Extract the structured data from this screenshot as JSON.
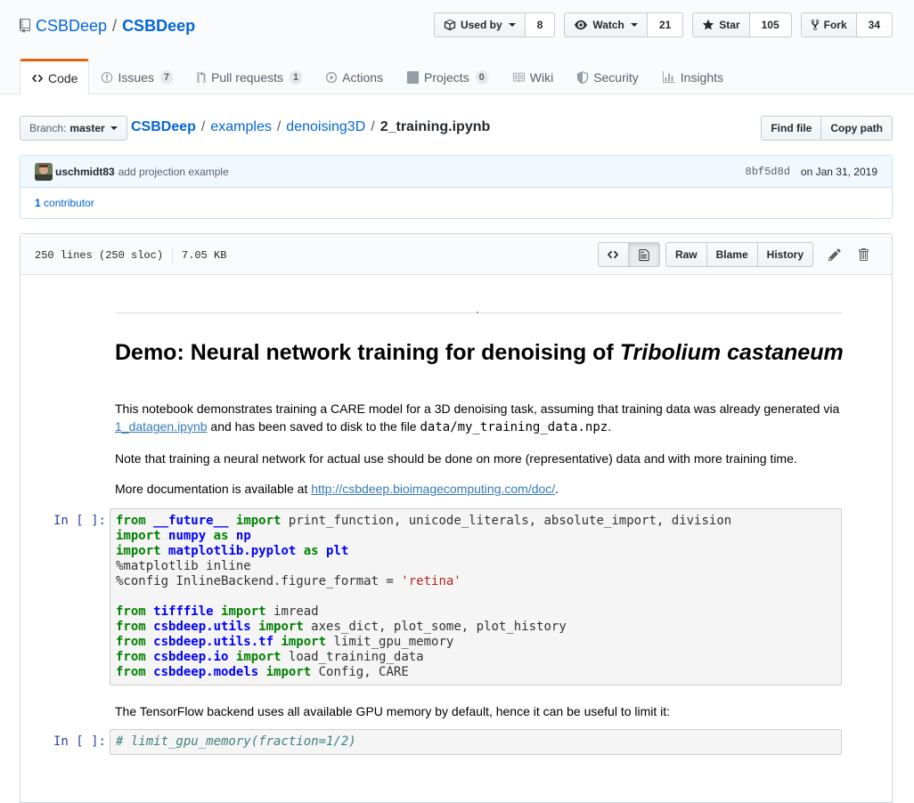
{
  "repo": {
    "owner": "CSBDeep",
    "separator": "/",
    "name": "CSBDeep"
  },
  "actions": {
    "used_by": {
      "label": "Used by",
      "count": "8"
    },
    "watch": {
      "label": "Watch",
      "count": "21"
    },
    "star": {
      "label": "Star",
      "count": "105"
    },
    "fork": {
      "label": "Fork",
      "count": "34"
    }
  },
  "tabs": [
    {
      "label": "Code",
      "icon": "code-icon",
      "selected": true
    },
    {
      "label": "Issues",
      "icon": "issue-icon",
      "counter": "7"
    },
    {
      "label": "Pull requests",
      "icon": "pull-request-icon",
      "counter": "1"
    },
    {
      "label": "Actions",
      "icon": "play-icon"
    },
    {
      "label": "Projects",
      "icon": "project-icon",
      "counter": "0"
    },
    {
      "label": "Wiki",
      "icon": "book-icon"
    },
    {
      "label": "Security",
      "icon": "shield-icon"
    },
    {
      "label": "Insights",
      "icon": "graph-icon"
    }
  ],
  "filenav": {
    "branch_prefix": "Branch:",
    "branch": "master",
    "crumbs": [
      "CSBDeep",
      "examples",
      "denoising3D"
    ],
    "separator": "/",
    "file": "2_training.ipynb",
    "find_file": "Find file",
    "copy_path": "Copy path"
  },
  "commit": {
    "author": "uschmidt83",
    "message": "add projection example",
    "sha": "8bf5d8d",
    "date": "on Jan 31, 2019",
    "contributors_count": "1",
    "contributors_label": "contributor"
  },
  "file": {
    "lines": "250 lines (250 sloc)",
    "size": "7.05 KB",
    "raw": "Raw",
    "blame": "Blame",
    "history": "History"
  },
  "notebook": {
    "title_main": "Demo: Neural network training for denoising of ",
    "title_italic": "Tribolium castaneum",
    "p1_a": "This notebook demonstrates training a CARE model for a 3D denoising task, assuming that training data was already generated via ",
    "p1_link": "1_datagen.ipynb",
    "p1_b": " and has been saved to disk to the file ",
    "p1_code": "data/my_training_data.npz",
    "p1_c": ".",
    "p2": "Note that training a neural network for actual use should be done on more (representative) data and with more training time.",
    "p3_a": "More documentation is available at ",
    "p3_link": "http://csbdeep.bioimagecomputing.com/doc/",
    "p3_b": ".",
    "prompt": "In [ ]:",
    "code1": [
      [
        [
          "kw",
          "from"
        ],
        [
          "t",
          " "
        ],
        [
          "nm",
          "__future__"
        ],
        [
          "t",
          " "
        ],
        [
          "kw",
          "import"
        ],
        [
          "t",
          " print_function, unicode_literals, absolute_import, division"
        ]
      ],
      [
        [
          "kw",
          "import"
        ],
        [
          "t",
          " "
        ],
        [
          "nm",
          "numpy"
        ],
        [
          "t",
          " "
        ],
        [
          "kw",
          "as"
        ],
        [
          "t",
          " "
        ],
        [
          "nm",
          "np"
        ]
      ],
      [
        [
          "kw",
          "import"
        ],
        [
          "t",
          " "
        ],
        [
          "nm",
          "matplotlib.pyplot"
        ],
        [
          "t",
          " "
        ],
        [
          "kw",
          "as"
        ],
        [
          "t",
          " "
        ],
        [
          "nm",
          "plt"
        ]
      ],
      [
        [
          "t",
          "%matplotlib inline"
        ]
      ],
      [
        [
          "t",
          "%config InlineBackend.figure_format = "
        ],
        [
          "st",
          "'retina'"
        ]
      ],
      [
        [
          "t",
          ""
        ]
      ],
      [
        [
          "kw",
          "from"
        ],
        [
          "t",
          " "
        ],
        [
          "nm",
          "tifffile"
        ],
        [
          "t",
          " "
        ],
        [
          "kw",
          "import"
        ],
        [
          "t",
          " imread"
        ]
      ],
      [
        [
          "kw",
          "from"
        ],
        [
          "t",
          " "
        ],
        [
          "nm",
          "csbdeep.utils"
        ],
        [
          "t",
          " "
        ],
        [
          "kw",
          "import"
        ],
        [
          "t",
          " axes_dict, plot_some, plot_history"
        ]
      ],
      [
        [
          "kw",
          "from"
        ],
        [
          "t",
          " "
        ],
        [
          "nm",
          "csbdeep.utils.tf"
        ],
        [
          "t",
          " "
        ],
        [
          "kw",
          "import"
        ],
        [
          "t",
          " limit_gpu_memory"
        ]
      ],
      [
        [
          "kw",
          "from"
        ],
        [
          "t",
          " "
        ],
        [
          "nm",
          "csbdeep.io"
        ],
        [
          "t",
          " "
        ],
        [
          "kw",
          "import"
        ],
        [
          "t",
          " load_training_data"
        ]
      ],
      [
        [
          "kw",
          "from"
        ],
        [
          "t",
          " "
        ],
        [
          "nm",
          "csbdeep.models"
        ],
        [
          "t",
          " "
        ],
        [
          "kw",
          "import"
        ],
        [
          "t",
          " Config, CARE"
        ]
      ]
    ],
    "p4": "The TensorFlow backend uses all available GPU memory by default, hence it can be useful to limit it:",
    "code2": [
      [
        [
          "cm",
          "# limit_gpu_memory(fraction=1/2)"
        ]
      ]
    ]
  }
}
